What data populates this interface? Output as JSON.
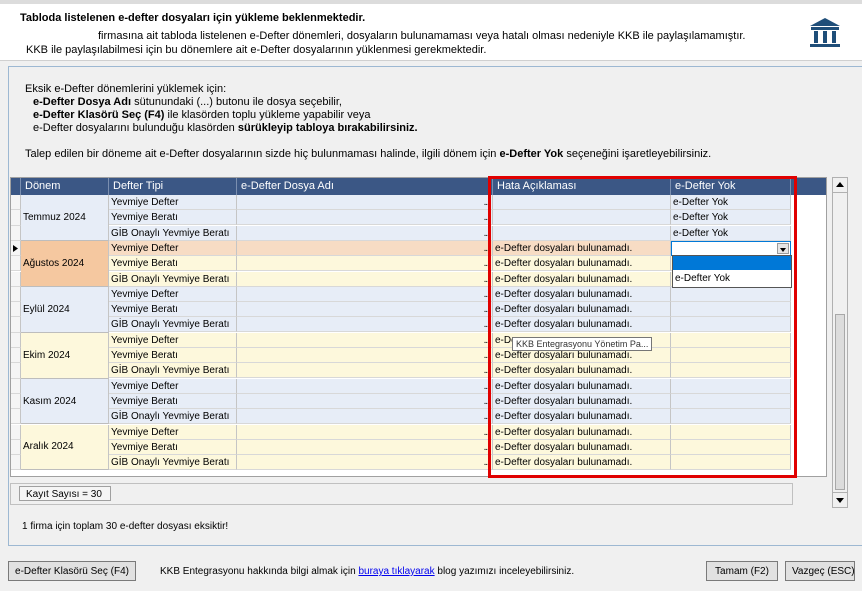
{
  "header": {
    "title": "Tabloda listelenen e-defter dosyaları için yükleme beklenmektedir.",
    "line2": "firmasına ait tabloda listelenen e-Defter dönemleri, dosyaların bulunamaması veya hatalı olması nedeniyle KKB ile paylaşılamamıştır.",
    "line3": "KKB ile paylaşılabilmesi için bu dönemlere ait e-Defter dosyalarının yüklenmesi gerekmektedir."
  },
  "instructions": {
    "intro": "Eksik e-Defter dönemlerini yüklemek için:",
    "l1_bold": "e-Defter Dosya Adı",
    "l1_rest": " sütunundaki (...) butonu ile dosya seçebilir,",
    "l2_bold": "e-Defter Klasörü Seç (F4)",
    "l2_rest": " ile klasörden toplu yükleme yapabilir veya",
    "l3_pre": "e-Defter dosyalarını bulunduğu klasörden ",
    "l3_bold": "sürükleyip tabloya bırakabilirsiniz.",
    "note_pre": "Talep edilen bir döneme ait e-Defter dosyalarının sizde hiç bulunmaması halinde, ilgili dönem için ",
    "note_bold": "e-Defter Yok",
    "note_post": " seçeneğini işaretleyebilirsiniz."
  },
  "grid": {
    "columns": [
      "Dönem",
      "Defter Tipi",
      "e-Defter Dosya Adı",
      "Hata Açıklaması",
      "e-Defter Yok"
    ],
    "groups": [
      {
        "donem": "Temmuz 2024",
        "rows": [
          {
            "tip": "Yevmiye Defter",
            "hata": "",
            "yok": "e-Defter Yok"
          },
          {
            "tip": "Yevmiye Beratı",
            "hata": "",
            "yok": "e-Defter Yok"
          },
          {
            "tip": "GİB Onaylı Yevmiye Beratı",
            "hata": "",
            "yok": "e-Defter Yok"
          }
        ]
      },
      {
        "donem": "Ağustos 2024",
        "rows": [
          {
            "tip": "Yevmiye Defter",
            "hata": "e-Defter dosyaları bulunamadı.",
            "yok": ""
          },
          {
            "tip": "Yevmiye Beratı",
            "hata": "e-Defter dosyaları bulunamadı.",
            "yok": ""
          },
          {
            "tip": "GİB Onaylı Yevmiye Beratı",
            "hata": "e-Defter dosyaları bulunamadı.",
            "yok": ""
          }
        ]
      },
      {
        "donem": "Eylül 2024",
        "rows": [
          {
            "tip": "Yevmiye Defter",
            "hata": "e-Defter dosyaları bulunamadı.",
            "yok": ""
          },
          {
            "tip": "Yevmiye Beratı",
            "hata": "e-Defter dosyaları bulunamadı.",
            "yok": ""
          },
          {
            "tip": "GİB Onaylı Yevmiye Beratı",
            "hata": "e-Defter dosyaları bulunamadı.",
            "yok": ""
          }
        ]
      },
      {
        "donem": "Ekim 2024",
        "rows": [
          {
            "tip": "Yevmiye Defter",
            "hata": "e-De",
            "yok": ""
          },
          {
            "tip": "Yevmiye Beratı",
            "hata": "e-Defter dosyaları bulunamadı.",
            "yok": ""
          },
          {
            "tip": "GİB Onaylı Yevmiye Beratı",
            "hata": "e-Defter dosyaları bulunamadı.",
            "yok": ""
          }
        ]
      },
      {
        "donem": "Kasım 2024",
        "rows": [
          {
            "tip": "Yevmiye Defter",
            "hata": "e-Defter dosyaları bulunamadı.",
            "yok": ""
          },
          {
            "tip": "Yevmiye Beratı",
            "hata": "e-Defter dosyaları bulunamadı.",
            "yok": ""
          },
          {
            "tip": "GİB Onaylı Yevmiye Beratı",
            "hata": "e-Defter dosyaları bulunamadı.",
            "yok": ""
          }
        ]
      },
      {
        "donem": "Aralık 2024",
        "rows": [
          {
            "tip": "Yevmiye Defter",
            "hata": "e-Defter dosyaları bulunamadı.",
            "yok": ""
          },
          {
            "tip": "Yevmiye Beratı",
            "hata": "e-Defter dosyaları bulunamadı.",
            "yok": ""
          },
          {
            "tip": "GİB Onaylı Yevmiye Beratı",
            "hata": "e-Defter dosyaları bulunamadı.",
            "yok": ""
          }
        ]
      }
    ],
    "browse_glyph": "...",
    "dropdown_options": [
      "",
      "e-Defter Yok"
    ]
  },
  "tooltip": "KKB Entegrasyonu Yönetim Pa...",
  "record_count": "Kayıt Sayısı = 30",
  "summary": "1 firma için toplam 30 e-defter dosyası eksiktir!",
  "footer": {
    "folder_button": "e-Defter Klasörü Seç (F4)",
    "info_pre": "KKB Entegrasyonu hakkında bilgi almak için ",
    "info_link": "buraya tıklayarak",
    "info_post": " blog yazımızı inceleyebilirsiniz.",
    "ok_button": "Tamam (F2)",
    "cancel_button": "Vazgeç (ESC)"
  },
  "colors": {
    "header_bg": "#3b5785",
    "group_a": "#e7edf7",
    "group_b": "#fdf8dc",
    "selected_donem": "#f5c8a0",
    "selected_row": "#f7dcc4",
    "highlight_border": "#e00000",
    "bank_icon": "#1f4e79"
  },
  "icons": {
    "bank": "bank-icon",
    "row_selector": "row-pointer-icon",
    "dropdown": "chevron-down-icon"
  }
}
